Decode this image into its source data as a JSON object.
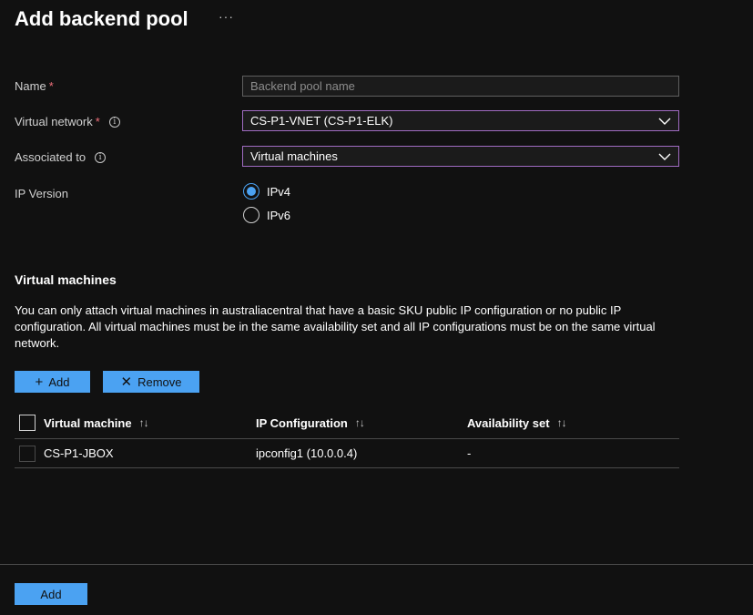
{
  "header": {
    "title": "Add backend pool",
    "more": "···"
  },
  "form": {
    "name": {
      "label": "Name",
      "required": "*",
      "placeholder": "Backend pool name",
      "value": ""
    },
    "virtual_network": {
      "label": "Virtual network",
      "required": "*",
      "value": "CS-P1-VNET (CS-P1-ELK)"
    },
    "associated_to": {
      "label": "Associated to",
      "value": "Virtual machines"
    },
    "ip_version": {
      "label": "IP Version",
      "options": [
        "IPv4",
        "IPv6"
      ],
      "selected": "IPv4"
    }
  },
  "vm_section": {
    "title": "Virtual machines",
    "description": "You can only attach virtual machines in australiacentral that have a basic SKU public IP configuration or no public IP configuration. All virtual machines must be in the same availability set and all IP configurations must be on the same virtual network.",
    "add_label": "Add",
    "remove_label": "Remove"
  },
  "table": {
    "columns": [
      "Virtual machine",
      "IP Configuration",
      "Availability set"
    ],
    "sort_glyph": "↑↓",
    "rows": [
      {
        "vm": "CS-P1-JBOX",
        "ip": "ipconfig1 (10.0.0.4)",
        "availability": "-"
      }
    ]
  },
  "footer": {
    "add_label": "Add"
  },
  "colors": {
    "accent": "#4ba2f2",
    "select_border": "#a06bc2",
    "required": "#f1707b",
    "background": "#111111"
  },
  "icons": [
    "more-icon",
    "info-icon",
    "chevron-down-icon",
    "plus-icon",
    "close-icon",
    "sort-icon"
  ]
}
